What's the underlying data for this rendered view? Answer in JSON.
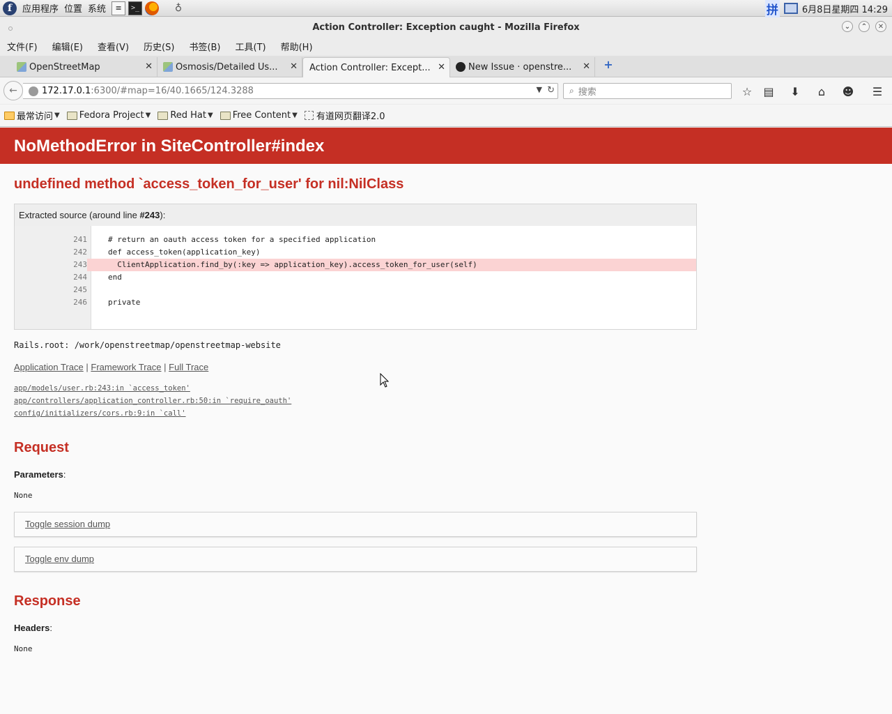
{
  "os_panel": {
    "menus": [
      "应用程序",
      "位置",
      "系统"
    ],
    "clock": "6月8日星期四 14:29",
    "ime_label": "拼"
  },
  "window": {
    "title": "Action Controller: Exception caught - Mozilla Firefox"
  },
  "menubar": [
    "文件(F)",
    "编辑(E)",
    "查看(V)",
    "历史(S)",
    "书签(B)",
    "工具(T)",
    "帮助(H)"
  ],
  "tabs": [
    {
      "label": "OpenStreetMap",
      "icon": "osm-icon"
    },
    {
      "label": "Osmosis/Detailed Us...",
      "icon": "osm-icon"
    },
    {
      "label": "Action Controller: Except...",
      "icon": "none",
      "active": true
    },
    {
      "label": "New Issue · openstre...",
      "icon": "github-icon"
    }
  ],
  "navbar": {
    "url_host": "172.17.0.1",
    "url_rest": ":6300/#map=16/40.1665/124.3288",
    "search_placeholder": "搜索"
  },
  "bookmarks": [
    "最常访问",
    "Fedora Project",
    "Red Hat",
    "Free Content",
    "有道网页翻译2.0"
  ],
  "page": {
    "header": "NoMethodError in SiteController#index",
    "message": "undefined method `access_token_for_user' for nil:NilClass",
    "source_caption_prefix": "Extracted source (around line ",
    "source_caption_line": "#243",
    "source_caption_suffix": "):",
    "source_lines": [
      {
        "num": "241",
        "code": "# return an oauth access token for a specified application"
      },
      {
        "num": "242",
        "code": "def access_token(application_key)"
      },
      {
        "num": "243",
        "code": "  ClientApplication.find_by(:key => application_key).access_token_for_user(self)",
        "highlight": true
      },
      {
        "num": "244",
        "code": "end"
      },
      {
        "num": "245",
        "code": ""
      },
      {
        "num": "246",
        "code": "private"
      }
    ],
    "rails_root": "Rails.root: /work/openstreetmap/openstreetmap-website",
    "trace_links": [
      "Application Trace",
      "Framework Trace",
      "Full Trace"
    ],
    "trace_separator": "|",
    "trace_lines": [
      "app/models/user.rb:243:in `access_token'",
      "app/controllers/application_controller.rb:50:in `require_oauth'",
      "config/initializers/cors.rb:9:in `call'"
    ],
    "request_heading": "Request",
    "parameters_label": "Parameters",
    "parameters_value": "None",
    "toggle_session": "Toggle session dump",
    "toggle_env": "Toggle env dump",
    "response_heading": "Response",
    "headers_label": "Headers",
    "headers_value": "None",
    "colon": ":"
  },
  "colors": {
    "error_red": "#c52f24",
    "highlight_line": "#fbd3d3"
  }
}
